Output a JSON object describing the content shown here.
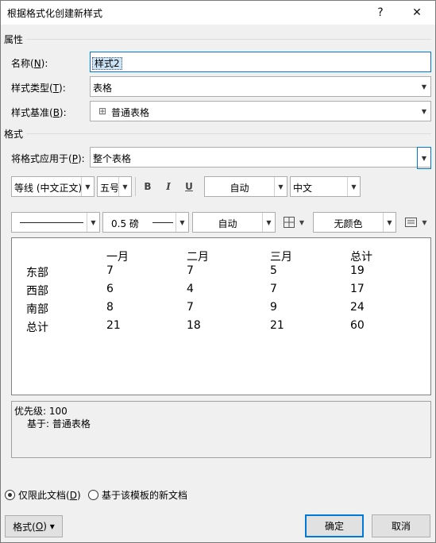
{
  "window": {
    "title": "根据格式化创建新样式",
    "help_label": "?",
    "close_label": "✕"
  },
  "properties": {
    "section_label": "属性",
    "name_label": "名称(",
    "name_key": "N",
    "name_suffix": "):",
    "name_value": "样式2",
    "type_label": "样式类型(",
    "type_key": "T",
    "type_suffix": "):",
    "type_value": "表格",
    "based_label": "样式基准(",
    "based_key": "B",
    "based_suffix": "):",
    "based_icon": "⊞",
    "based_value": "普通表格"
  },
  "format": {
    "section_label": "格式",
    "apply_label": "将格式应用于(",
    "apply_key": "P",
    "apply_suffix": "):",
    "apply_value": "整个表格",
    "font_value": "等线 (中文正文)",
    "size_value": "五号",
    "bold_label": "B",
    "italic_label": "I",
    "underline_label": "U",
    "color_value": "自动",
    "lang_value": "中文",
    "line_weight_value": "0.5 磅",
    "border_color_value": "自动",
    "fill_value": "无颜色"
  },
  "preview": {
    "headers": [
      "一月",
      "二月",
      "三月",
      "总计"
    ],
    "rows": [
      {
        "label": "东部",
        "values": [
          "7",
          "7",
          "5",
          "19"
        ]
      },
      {
        "label": "西部",
        "values": [
          "6",
          "4",
          "7",
          "17"
        ]
      },
      {
        "label": "南部",
        "values": [
          "8",
          "7",
          "9",
          "24"
        ]
      },
      {
        "label": "总计",
        "values": [
          "21",
          "18",
          "21",
          "60"
        ]
      }
    ]
  },
  "description": {
    "line1": "优先级: 100",
    "line2": "基于: 普通表格"
  },
  "options": {
    "this_doc_label": "仅限此文档(",
    "this_doc_key": "D",
    "this_doc_suffix": ")",
    "template_label": "基于该模板的新文档"
  },
  "footer": {
    "format_label": "格式(",
    "format_key": "O",
    "format_suffix": ") ▾",
    "ok_label": "确定",
    "cancel_label": "取消"
  }
}
